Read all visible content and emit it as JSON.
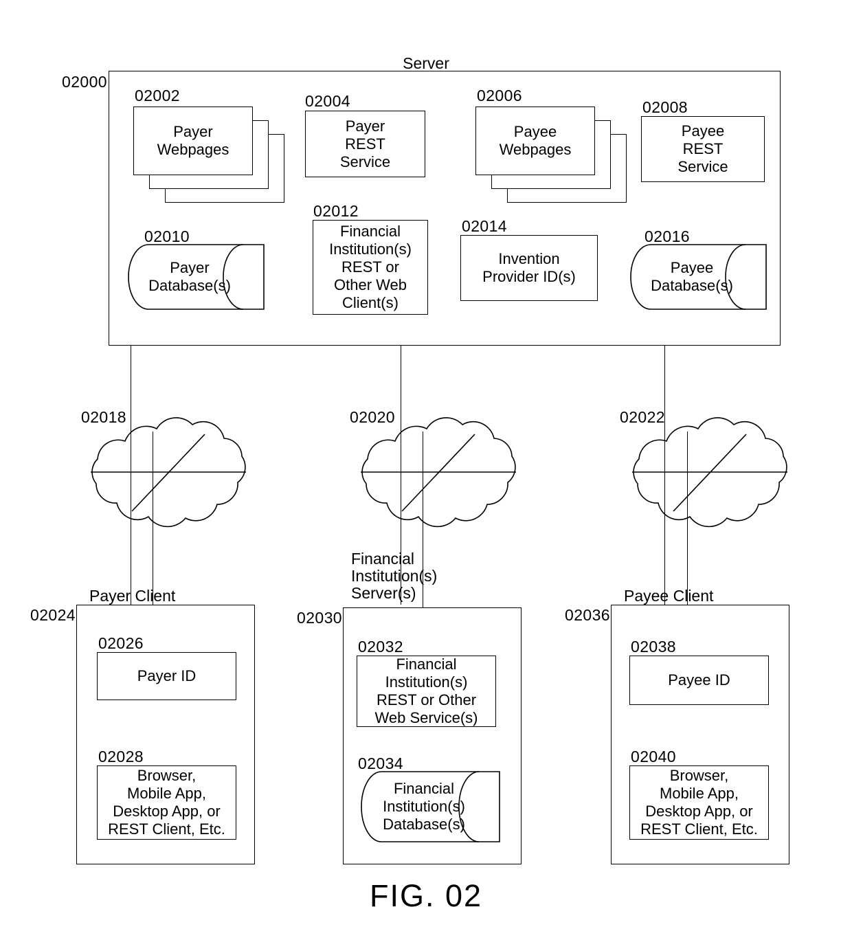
{
  "figure": {
    "title": "FIG. 02",
    "sheet_background": "#ffffff",
    "line_color": "#000000"
  },
  "server": {
    "ref": "02000",
    "title": "Server",
    "components": {
      "payer_webpages": {
        "ref": "02002",
        "label": "Payer\nWebpages",
        "shape": "stacked-pages"
      },
      "payer_rest_service": {
        "ref": "02004",
        "label": "Payer\nREST\nService",
        "shape": "rect"
      },
      "payee_webpages": {
        "ref": "02006",
        "label": "Payee\nWebpages",
        "shape": "stacked-pages"
      },
      "payee_rest_service": {
        "ref": "02008",
        "label": "Payee\nREST\nService",
        "shape": "rect"
      },
      "payer_database": {
        "ref": "02010",
        "label": "Payer\nDatabase(s)",
        "shape": "cylinder"
      },
      "fi_rest_client": {
        "ref": "02012",
        "label": "Financial\nInstitution(s)\nREST or\nOther Web\nClient(s)",
        "shape": "rect"
      },
      "invention_provider_id": {
        "ref": "02014",
        "label": "Invention\nProvider ID(s)",
        "shape": "rect"
      },
      "payee_database": {
        "ref": "02016",
        "label": "Payee\nDatabase(s)",
        "shape": "cylinder"
      }
    }
  },
  "networks": [
    {
      "ref": "02018",
      "label": "",
      "shape": "cloud"
    },
    {
      "ref": "02020",
      "label": "Financial\nInstitution(s)\nServer(s)",
      "shape": "cloud"
    },
    {
      "ref": "02022",
      "label": "",
      "shape": "cloud"
    }
  ],
  "payer_client": {
    "ref": "02024",
    "title": "Payer Client",
    "components": {
      "payer_id": {
        "ref": "02026",
        "label": "Payer ID",
        "shape": "rect"
      },
      "client_apps": {
        "ref": "02028",
        "label": "Browser,\nMobile App,\nDesktop App, or\nREST Client, Etc.",
        "shape": "rect"
      }
    }
  },
  "fi_server": {
    "ref": "02030",
    "title": "Financial\nInstitution(s)\nServer(s)",
    "components": {
      "fi_web_service": {
        "ref": "02032",
        "label": "Financial\nInstitution(s)\nREST or Other\nWeb Service(s)",
        "shape": "rect"
      },
      "fi_database": {
        "ref": "02034",
        "label": "Financial\nInstitution(s)\nDatabase(s)",
        "shape": "cylinder"
      }
    }
  },
  "payee_client": {
    "ref": "02036",
    "title": "Payee Client",
    "components": {
      "payee_id": {
        "ref": "02038",
        "label": "Payee ID",
        "shape": "rect"
      },
      "client_apps": {
        "ref": "02040",
        "label": "Browser,\nMobile App,\nDesktop App, or\nREST Client, Etc.",
        "shape": "rect"
      }
    }
  }
}
